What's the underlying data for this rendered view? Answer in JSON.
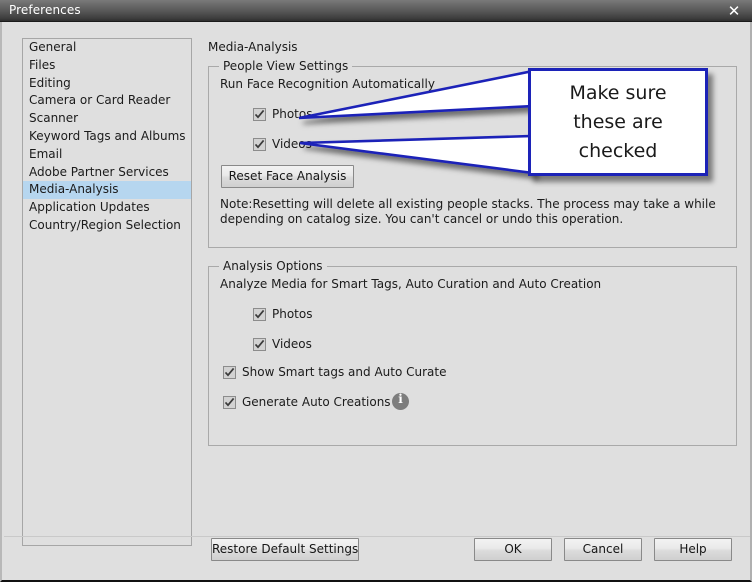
{
  "window": {
    "title": "Preferences",
    "close_icon": "close-icon",
    "close_glyph": "✕"
  },
  "sidebar": {
    "items": [
      {
        "label": "General",
        "selected": false
      },
      {
        "label": "Files",
        "selected": false
      },
      {
        "label": "Editing",
        "selected": false
      },
      {
        "label": "Camera or Card Reader",
        "selected": false
      },
      {
        "label": "Scanner",
        "selected": false
      },
      {
        "label": "Keyword Tags and Albums",
        "selected": false
      },
      {
        "label": "Email",
        "selected": false
      },
      {
        "label": "Adobe Partner Services",
        "selected": false
      },
      {
        "label": "Media-Analysis",
        "selected": true
      },
      {
        "label": "Application Updates",
        "selected": false
      },
      {
        "label": "Country/Region Selection",
        "selected": false
      }
    ]
  },
  "panel": {
    "heading": "Media-Analysis",
    "people_view": {
      "legend": "People View Settings",
      "description": "Run Face Recognition Automatically",
      "checkboxes": [
        {
          "label": "Photos",
          "checked": true
        },
        {
          "label": "Videos",
          "checked": true
        }
      ],
      "reset_button": "Reset Face Analysis",
      "note": "Note:Resetting will delete all existing people stacks. The process may take a while depending on catalog size. You can't cancel or undo this operation."
    },
    "analysis_options": {
      "legend": "Analysis Options",
      "description": "Analyze Media for Smart Tags, Auto Curation and Auto Creation",
      "checkboxes": [
        {
          "label": "Photos",
          "checked": true
        },
        {
          "label": "Videos",
          "checked": true
        },
        {
          "label": "Show Smart tags and Auto Curate",
          "checked": true
        },
        {
          "label": "Generate Auto Creations",
          "checked": true
        }
      ],
      "info_icon": "info-icon"
    }
  },
  "footer": {
    "restore": "Restore Default Settings",
    "ok": "OK",
    "cancel": "Cancel",
    "help": "Help"
  },
  "annotation": {
    "text": "Make sure\nthese are\nchecked",
    "border_color": "#1c23b8",
    "fill_color": "#ffffff"
  }
}
